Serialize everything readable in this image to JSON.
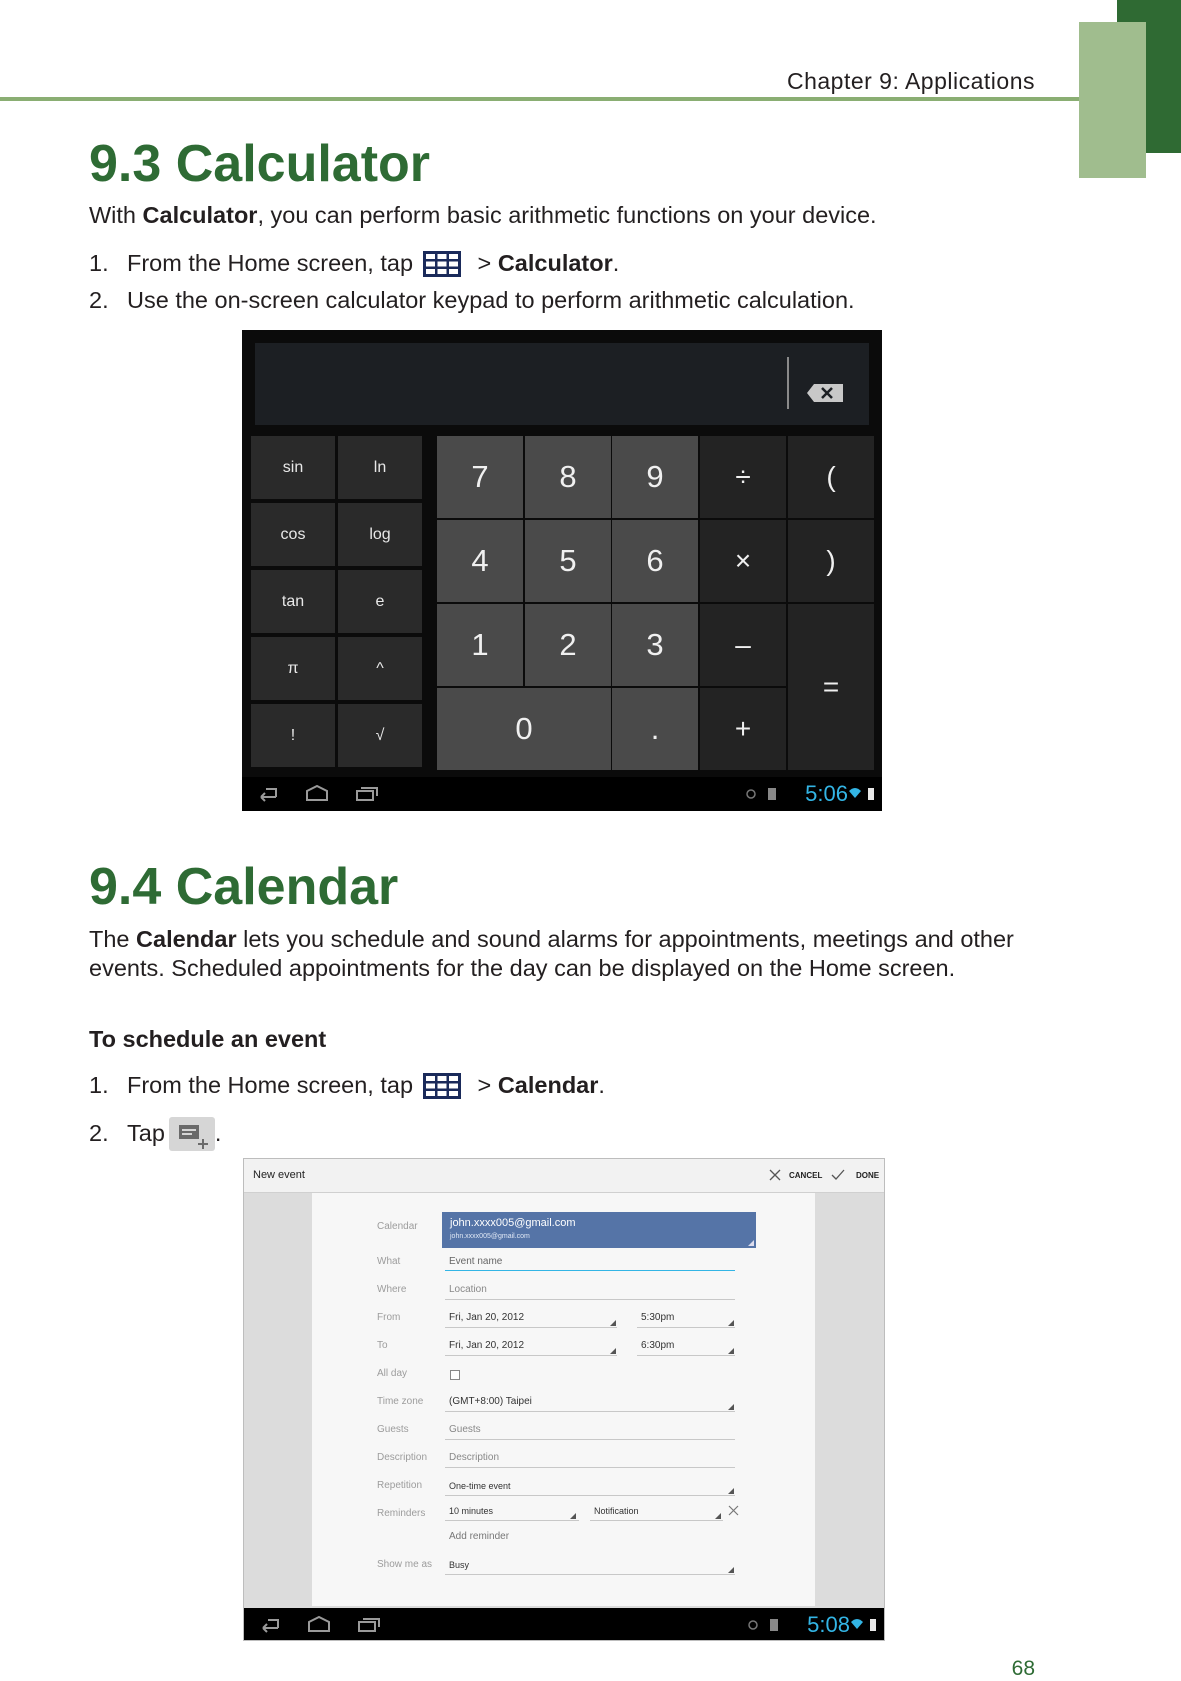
{
  "header": {
    "chapter": "Chapter 9: Applications"
  },
  "calculator_section": {
    "title": "9.3 Calculator",
    "intro_prefix": "With ",
    "intro_bold": "Calculator",
    "intro_suffix": ", you can perform basic arithmetic functions on your device.",
    "steps": [
      {
        "num": "1.",
        "prefix": "From the Home screen, tap",
        "sep": " > ",
        "bold": "Calculator",
        "suffix": "."
      },
      {
        "num": "2.",
        "text": "Use the on-screen calculator keypad to perform arithmetic calculation."
      }
    ],
    "screenshot": {
      "advanced_keys": [
        "sin",
        "ln",
        "cos",
        "log",
        "tan",
        "e",
        "π",
        "^",
        "!",
        "√"
      ],
      "number_keys": [
        "7",
        "8",
        "9",
        "4",
        "5",
        "6",
        "1",
        "2",
        "3",
        "0",
        "."
      ],
      "operator_keys": [
        "÷",
        "(",
        "×",
        ")",
        "–",
        "=",
        "+"
      ],
      "clock": "5:06"
    }
  },
  "calendar_section": {
    "title": "9.4 Calendar",
    "intro_prefix": "The ",
    "intro_bold": "Calendar",
    "intro_suffix": " lets you schedule and sound alarms for appointments, meetings and other events. Scheduled appointments for the day can be displayed on the Home screen.",
    "subheading": "To schedule an event",
    "steps": [
      {
        "num": "1.",
        "prefix": "From the Home screen, tap",
        "sep": " > ",
        "bold": "Calendar",
        "suffix": "."
      },
      {
        "num": "2.",
        "prefix": "Tap",
        "suffix": "."
      }
    ],
    "screenshot": {
      "title": "New event",
      "cancel_label": "CANCEL",
      "done_label": "DONE",
      "labels": {
        "calendar": "Calendar",
        "what": "What",
        "where": "Where",
        "from": "From",
        "to": "To",
        "all_day": "All day",
        "time_zone": "Time zone",
        "guests": "Guests",
        "description": "Description",
        "repetition": "Repetition",
        "reminders": "Reminders",
        "show_me_as": "Show me as"
      },
      "account_name": "john.xxxx005@gmail.com",
      "account_email": "john.xxxx005@gmail.com",
      "what_placeholder": "Event name",
      "where_placeholder": "Location",
      "from_date": "Fri, Jan 20, 2012",
      "from_time": "5:30pm",
      "to_date": "Fri, Jan 20, 2012",
      "to_time": "6:30pm",
      "time_zone": "(GMT+8:00) Taipei",
      "guests_placeholder": "Guests",
      "description_placeholder": "Description",
      "repetition": "One-time event",
      "reminder_time": "10 minutes",
      "reminder_method": "Notification",
      "add_reminder": "Add reminder",
      "show_me_as": "Busy",
      "clock": "5:08"
    }
  },
  "page_number": "68",
  "colors": {
    "heading_green": "#2e6b34",
    "rule_green": "#8aae73",
    "tab_dark": "#2f6a33",
    "tab_light": "#a0bd8e",
    "clock_blue": "#33b5e5"
  }
}
